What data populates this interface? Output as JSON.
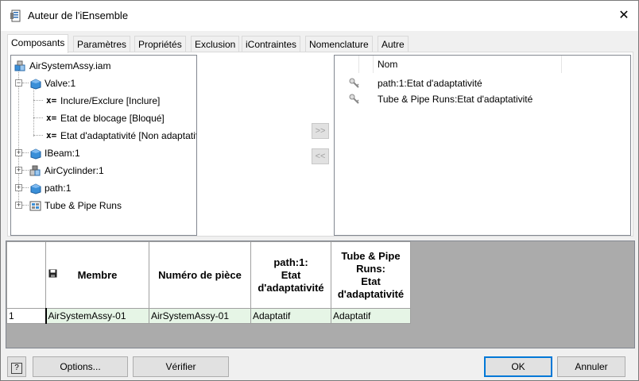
{
  "window": {
    "title": "Auteur de l'iEnsemble",
    "close_glyph": "✕"
  },
  "tabs": [
    {
      "label": "Composants",
      "active": true
    },
    {
      "label": "Paramètres"
    },
    {
      "label": "Propriétés"
    },
    {
      "label": "Exclusion"
    },
    {
      "label": "iContraintes"
    },
    {
      "label": "Nomenclature"
    },
    {
      "label": "Autre"
    }
  ],
  "tree": {
    "root": {
      "label": "AirSystemAssy.iam",
      "icon": "assembly-icon"
    },
    "valve": {
      "label": "Valve:1",
      "expander": "−",
      "icon": "part-icon"
    },
    "valve_children": [
      {
        "prefix": "x=",
        "label": "Inclure/Exclure [Inclure]"
      },
      {
        "prefix": "x=",
        "label": "Etat de blocage [Bloqué]"
      },
      {
        "prefix": "x=",
        "label": "Etat d'adaptativité [Non adaptatif]"
      }
    ],
    "others": [
      {
        "label": "IBeam:1",
        "expander": "+",
        "icon": "part-icon"
      },
      {
        "label": "AirCyclinder:1",
        "expander": "+",
        "icon": "subassembly-icon"
      },
      {
        "label": "path:1",
        "expander": "+",
        "icon": "part-icon"
      },
      {
        "label": "Tube & Pipe Runs",
        "expander": "+",
        "icon": "tube-pipe-icon"
      }
    ]
  },
  "arrows": {
    "add": ">>",
    "remove": "<<"
  },
  "selected_list": {
    "header": "Nom",
    "items": [
      {
        "label": "path:1:Etat d'adaptativité",
        "icon": "key-icon"
      },
      {
        "label": "Tube & Pipe Runs:Etat d'adaptativité",
        "icon": "key-icon"
      }
    ]
  },
  "grid": {
    "columns": [
      "Membre",
      "Numéro de pièce",
      "path:1:\nEtat\nd'adaptativité",
      "Tube & Pipe\nRuns:\nEtat\nd'adaptativité"
    ],
    "rows": [
      {
        "index": "1",
        "cells": [
          "AirSystemAssy-01",
          "AirSystemAssy-01",
          "Adaptatif",
          "Adaptatif"
        ]
      }
    ],
    "cell_color": "#e6f5e6"
  },
  "buttons": {
    "help": "?",
    "options": "Options...",
    "verify": "Vérifier",
    "ok": "OK",
    "cancel": "Annuler"
  }
}
